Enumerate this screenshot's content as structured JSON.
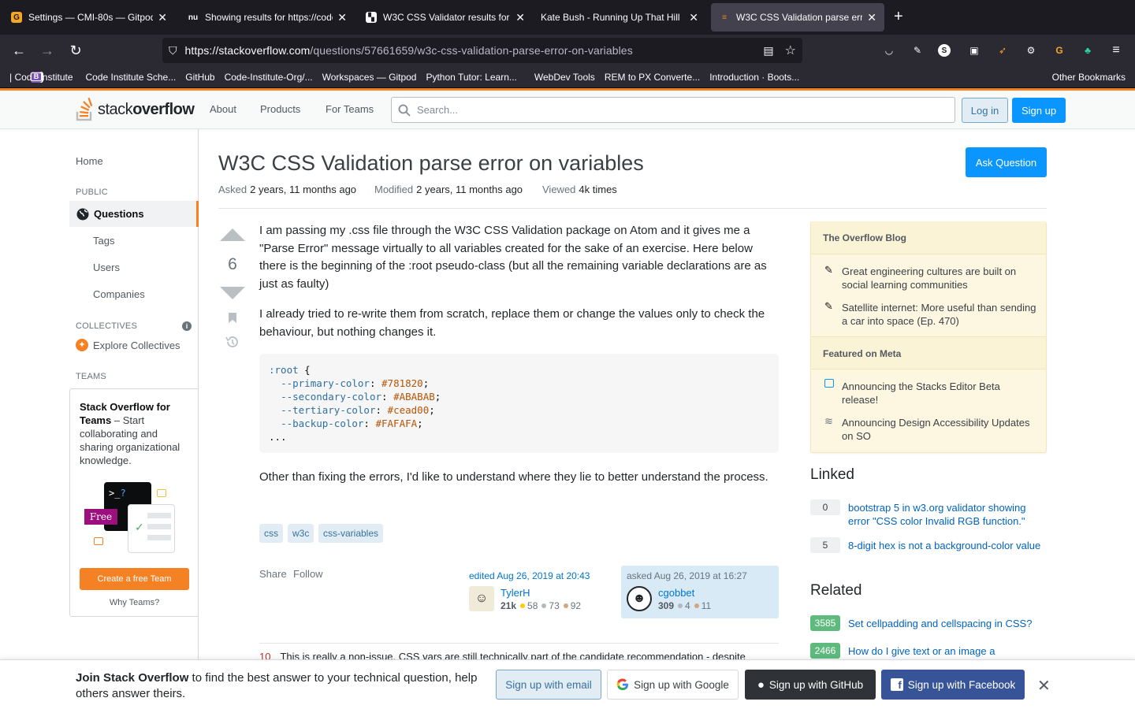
{
  "browser": {
    "tabs": [
      {
        "title": "Settings — CMI-80s — Gitpod C",
        "close": "✕"
      },
      {
        "title": "Showing results for https://code",
        "close": "✕"
      },
      {
        "title": "W3C CSS Validator results for ht",
        "close": "✕"
      },
      {
        "title": "Kate Bush - Running Up That Hill",
        "close": "✕"
      },
      {
        "title": "W3C CSS Validation parse error",
        "close": "✕"
      }
    ],
    "new_tab": "+",
    "url_domain": "https://stackoverflow.com",
    "url_path": "/questions/57661659/w3c-css-validation-parse-error-on-variables",
    "bookmarks": [
      {
        "label": "| Code Institute",
        "icon": "code-institute-icon"
      },
      {
        "label": "Code Institute Sche...",
        "icon": "code-institute-icon"
      },
      {
        "label": "GitHub",
        "icon": "github-icon"
      },
      {
        "label": "Code-Institute-Org/...",
        "icon": "github-icon"
      },
      {
        "label": "Workspaces — Gitpod",
        "icon": "gitpod-icon"
      },
      {
        "label": "Python Tutor: Learn...",
        "icon": "python-icon"
      },
      {
        "label": "WebDev Tools",
        "icon": "folder-icon"
      },
      {
        "label": "REM to PX Converte...",
        "icon": "cb-icon"
      },
      {
        "label": "Introduction · Boots...",
        "icon": "bootstrap-icon"
      }
    ],
    "other_bookmarks": "Other Bookmarks"
  },
  "header": {
    "logo_light": "stack",
    "logo_bold": "overflow",
    "nav": [
      "About",
      "Products",
      "For Teams"
    ],
    "search_placeholder": "Search...",
    "login": "Log in",
    "signup": "Sign up"
  },
  "leftnav": {
    "home": "Home",
    "public": "PUBLIC",
    "questions": "Questions",
    "tags": "Tags",
    "users": "Users",
    "companies": "Companies",
    "collectives": "COLLECTIVES",
    "explore": "Explore Collectives",
    "teams": "TEAMS",
    "teams_title": "Stack Overflow for Teams",
    "teams_desc": " – Start collaborating and sharing organizational knowledge.",
    "free_badge": "Free",
    "create_team": "Create a free Team",
    "why_teams": "Why Teams?"
  },
  "question": {
    "title": "W3C CSS Validation parse error on variables",
    "ask_button": "Ask Question",
    "asked_label": "Asked",
    "asked": "2 years, 11 months ago",
    "modified_label": "Modified",
    "modified": "2 years, 11 months ago",
    "viewed_label": "Viewed",
    "viewed": "4k times",
    "score": "6",
    "body_p1": "I am passing my .css file through the W3C CSS Validation package on Atom and it gives me a \"Parse Error\" message virtually to all variables created for the sake of an exercise. Here below there is the beginning of the :root pseudo-class (but all the remaining variable declarations are as just as faulty)",
    "body_p2": "I already tried to re-write them from scratch, replace them or change the values only to check the behaviour, but nothing changes it.",
    "code": {
      "selector": ":root",
      "open": " {",
      "lines": [
        {
          "prop": "--primary-color",
          "value": "#781820"
        },
        {
          "prop": "--secondary-color",
          "value": "#ABABAB"
        },
        {
          "prop": "--tertiary-color",
          "value": "#cead00"
        },
        {
          "prop": "--backup-color",
          "value": "#FAFAFA"
        }
      ],
      "ellipsis": "..."
    },
    "body_p3": "Other than fixing the errors, I'd like to understand where they lie to better understand the process.",
    "tags": [
      "css",
      "w3c",
      "css-variables"
    ],
    "share": "Share",
    "follow": "Follow",
    "editor": {
      "when": "edited Aug 26, 2019 at 20:43",
      "name": "TylerH",
      "rep": "21k",
      "gold": "58",
      "silver": "73",
      "bronze": "92"
    },
    "asker": {
      "when": "asked Aug 26, 2019 at 16:27",
      "name": "cgobbet",
      "rep": "309",
      "silver": "4",
      "bronze": "11"
    },
    "comment_score": "10",
    "comment_text": "This is really a non-issue. CSS vars are still technically part of the candidate recommendation - despite"
  },
  "sidebar": {
    "blog_title": "The Overflow Blog",
    "blog_items": [
      "Great engineering cultures are built on social learning communities",
      "Satellite internet: More useful than sending a car into space (Ep. 470)"
    ],
    "meta_title": "Featured on Meta",
    "meta_items": [
      "Announcing the Stacks Editor Beta release!",
      "Announcing Design Accessibility Updates on SO"
    ],
    "linked_title": "Linked",
    "linked": [
      {
        "score": "0",
        "text": "bootstrap 5 in w3.org validator showing error \"CSS color Invalid RGB function.\""
      },
      {
        "score": "5",
        "text": "8-digit hex is not a background-color value"
      }
    ],
    "related_title": "Related",
    "related": [
      {
        "score": "3585",
        "text": "Set cellpadding and cellspacing in CSS?"
      },
      {
        "score": "2466",
        "text": "How do I give text or an image a"
      }
    ]
  },
  "joinbar": {
    "bold": "Join Stack Overflow",
    "rest": " to find the best answer to your technical question, help others answer theirs.",
    "email": "Sign up with email",
    "google": "Sign up with Google",
    "github": "Sign up with GitHub",
    "facebook": "Sign up with Facebook",
    "close": "✕"
  },
  "colors": {
    "accent": "#f48225",
    "primary": "#0a95ff",
    "link": "#0074cc"
  }
}
